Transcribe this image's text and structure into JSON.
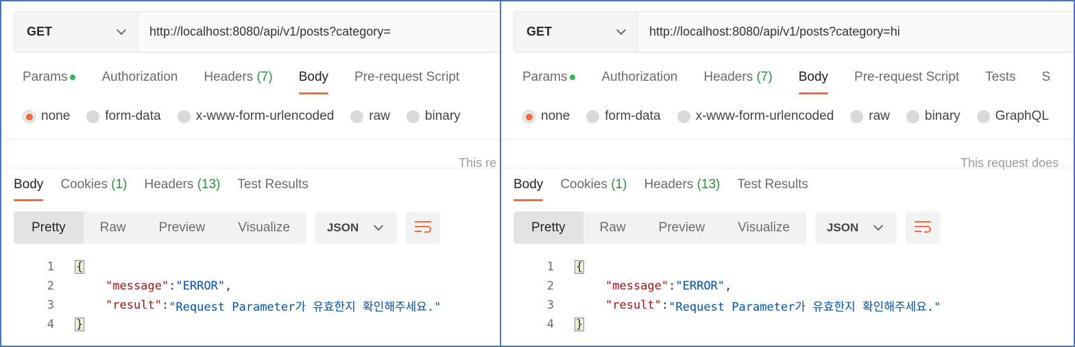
{
  "panels": [
    {
      "method": "GET",
      "url": "http://localhost:8080/api/v1/posts?category=",
      "request_tabs": [
        {
          "label": "Params",
          "dot": true
        },
        {
          "label": "Authorization"
        },
        {
          "label": "Headers",
          "count": "(7)"
        },
        {
          "label": "Body",
          "active": true
        },
        {
          "label": "Pre-request Script"
        }
      ],
      "body_types": [
        "none",
        "form-data",
        "x-www-form-urlencoded",
        "raw",
        "binary"
      ],
      "info_note": "This re",
      "response_tabs": [
        {
          "label": "Body",
          "active": true
        },
        {
          "label": "Cookies",
          "count": "(1)"
        },
        {
          "label": "Headers",
          "count": "(13)"
        },
        {
          "label": "Test Results"
        }
      ],
      "view_modes": [
        "Pretty",
        "Raw",
        "Preview",
        "Visualize"
      ],
      "format": "JSON",
      "code": {
        "line_numbers": [
          "1",
          "2",
          "3",
          "4"
        ],
        "open_brace": "{",
        "close_brace": "}",
        "message_key": "\"message\"",
        "message_value": "\"ERROR\"",
        "result_key": "\"result\"",
        "result_value": "\"Request Parameter가 유효한지 확인해주세요.\""
      }
    },
    {
      "method": "GET",
      "url": "http://localhost:8080/api/v1/posts?category=hi",
      "request_tabs": [
        {
          "label": "Params",
          "dot": true
        },
        {
          "label": "Authorization"
        },
        {
          "label": "Headers",
          "count": "(7)"
        },
        {
          "label": "Body",
          "active": true
        },
        {
          "label": "Pre-request Script"
        },
        {
          "label": "Tests"
        },
        {
          "label": "S"
        }
      ],
      "body_types": [
        "none",
        "form-data",
        "x-www-form-urlencoded",
        "raw",
        "binary",
        "GraphQL"
      ],
      "info_note": "This request does",
      "response_tabs": [
        {
          "label": "Body",
          "active": true
        },
        {
          "label": "Cookies",
          "count": "(1)"
        },
        {
          "label": "Headers",
          "count": "(13)"
        },
        {
          "label": "Test Results"
        }
      ],
      "view_modes": [
        "Pretty",
        "Raw",
        "Preview",
        "Visualize"
      ],
      "format": "JSON",
      "code": {
        "line_numbers": [
          "1",
          "2",
          "3",
          "4"
        ],
        "open_brace": "{",
        "close_brace": "}",
        "message_key": "\"message\"",
        "message_value": "\"ERROR\"",
        "result_key": "\"result\"",
        "result_value": "\"Request Parameter가 유효한지 확인해주세요.\""
      }
    }
  ],
  "colors": {
    "accent": "#f26b3a",
    "dot_green": "#2eb35a",
    "count_green": "#2e8a47",
    "json_key": "#a31515",
    "json_string": "#0451a5",
    "frame_border": "#4a72c4"
  },
  "icons": {
    "method_dropdown": "chevron-down-icon",
    "format_dropdown": "chevron-down-icon",
    "wrap": "wrap-lines-icon"
  }
}
